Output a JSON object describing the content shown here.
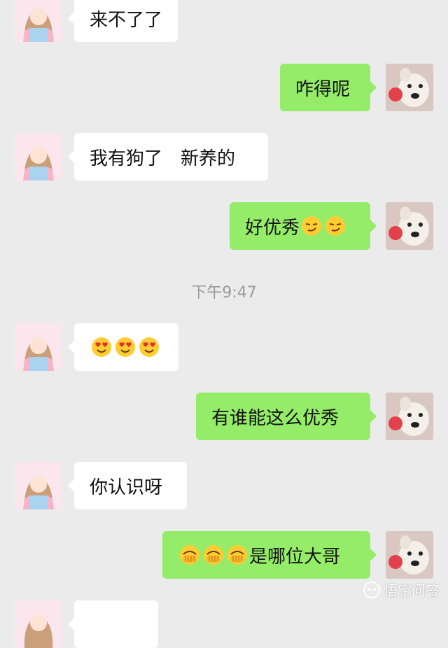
{
  "chat": {
    "messages": [
      {
        "side": "left",
        "text": "来不了了"
      },
      {
        "side": "right",
        "text": "咋得呢"
      },
      {
        "side": "left",
        "text": "我有狗了　新养的"
      },
      {
        "side": "right",
        "text": "好优秀",
        "emoji": [
          "smirk-emoji",
          "smirk-emoji"
        ]
      },
      {
        "side": "left",
        "text": "",
        "emoji": [
          "heart-eyes-emoji",
          "heart-eyes-emoji",
          "heart-eyes-emoji"
        ]
      },
      {
        "side": "right",
        "text": "有谁能这么优秀"
      },
      {
        "side": "left",
        "text": "你认识呀"
      },
      {
        "side": "right",
        "text": "是哪位大哥",
        "emoji_prefix": [
          "facepalm-emoji",
          "facepalm-emoji",
          "facepalm-emoji"
        ]
      }
    ],
    "timestamp": "下午9:47"
  },
  "watermark": {
    "text": "悟空问答"
  },
  "colors": {
    "background": "#ebebeb",
    "bubble_right": "#95ec69",
    "bubble_left": "#ffffff"
  }
}
